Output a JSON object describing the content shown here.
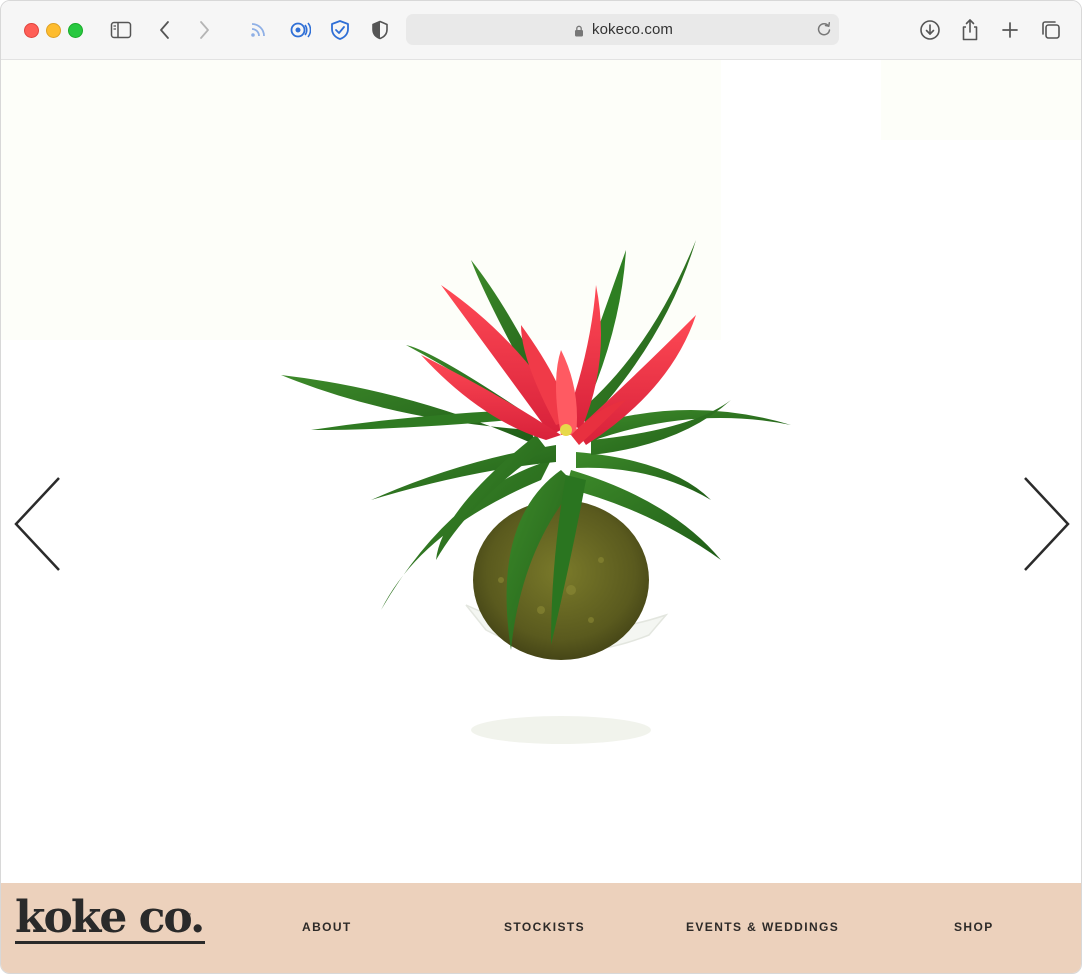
{
  "browser": {
    "url": "kokeco.com",
    "icons": [
      "sidebar-icon",
      "back-icon",
      "forward-icon",
      "rss-icon",
      "extension-icon",
      "shield-check-icon",
      "privacy-shield-icon",
      "lock-icon",
      "reload-icon",
      "download-icon",
      "share-icon",
      "new-tab-icon",
      "tab-overview-icon"
    ]
  },
  "hero": {
    "image": "plant-image",
    "prev_icon": "chevron-left-icon",
    "next_icon": "chevron-right-icon"
  },
  "footer": {
    "logo_text": "koke co.",
    "logo_tm": "™",
    "nav": {
      "about": "ABOUT",
      "stockists": "STOCKISTS",
      "events": "EVENTS & WEDDINGS",
      "shop": "SHOP"
    }
  },
  "colors": {
    "footer_bg": "#ecd1bc",
    "accent_blue": "#2f6fd6"
  }
}
